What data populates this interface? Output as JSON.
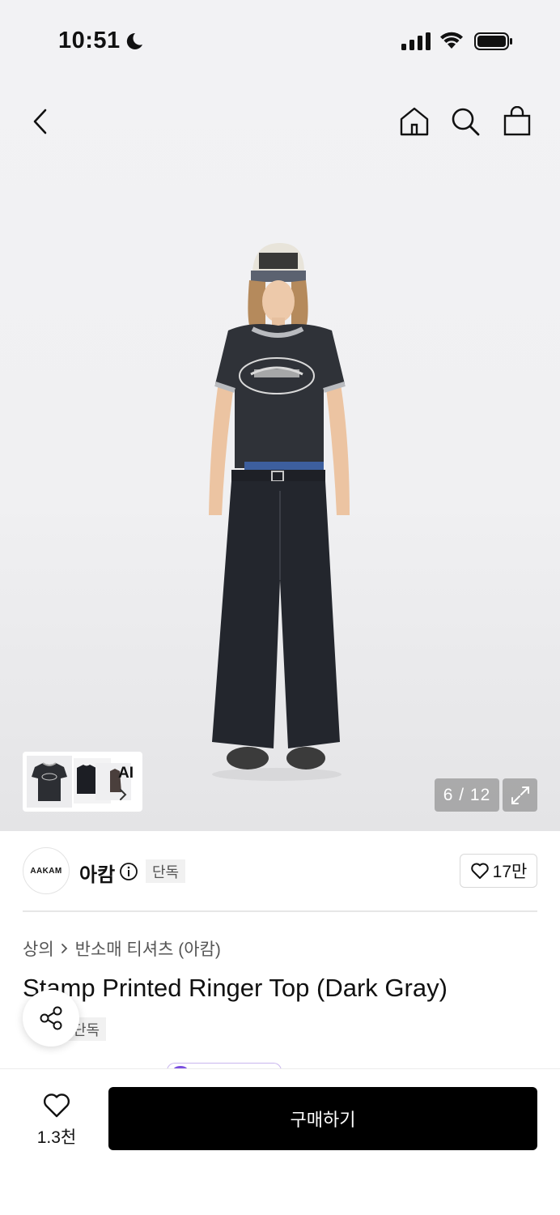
{
  "status_bar": {
    "time": "10:51"
  },
  "gallery": {
    "counter": "6 / 12",
    "ai_label": "AI"
  },
  "brand": {
    "logo_text": "AAKAM",
    "name": "아캄",
    "badge": "단독",
    "likes": "17만"
  },
  "product": {
    "breadcrumb": [
      "상의",
      "반소매 티셔츠 (아캄)"
    ],
    "title": "Stamp Printed Ringer Top (Dark Gray)",
    "badge": "단독"
  },
  "bottom_bar": {
    "wish_count": "1.3천",
    "buy_label": "구매하기"
  },
  "colors": {
    "accent": "#7b4fe0",
    "buy_button": "#000000",
    "hero_background": "#f0f0f2"
  }
}
